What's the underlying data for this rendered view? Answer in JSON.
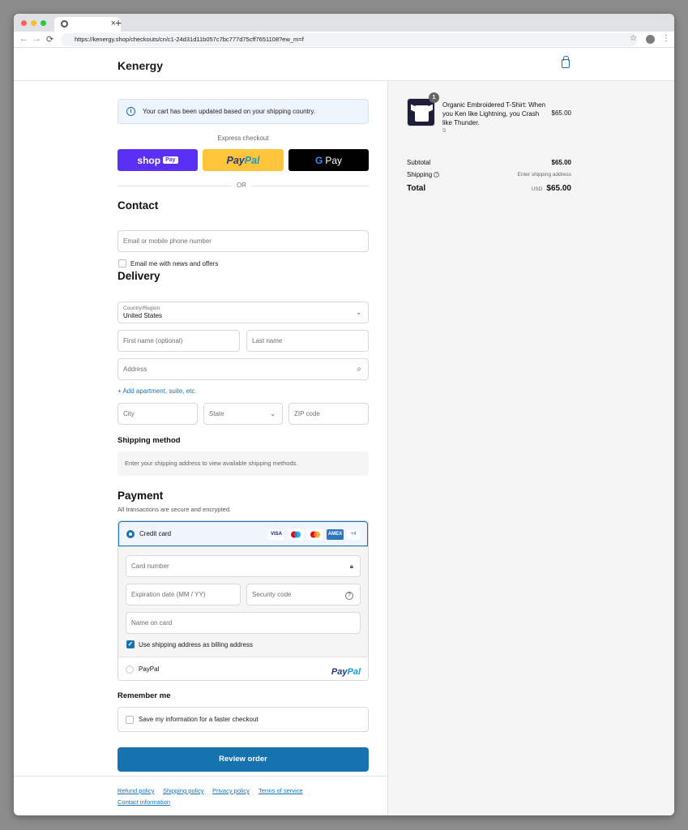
{
  "browser": {
    "tab_close": "×",
    "new_tab": "+",
    "url": "https://kenergy.shop/checkouts/cn/c1-24d31d11b057c7bc777d75cff7651108?ew_m=f",
    "back": "←",
    "forward": "→",
    "reload": "⟳",
    "star": "☆",
    "menu": "⋮"
  },
  "header": {
    "brand": "Kenergy"
  },
  "banner": {
    "icon": "i",
    "text": "Your cart has been updated based on your shipping country."
  },
  "express": {
    "label": "Express checkout",
    "shop_word": "shop",
    "shop_pay": "Pay",
    "paypal_1": "Pay",
    "paypal_2": "Pal",
    "gpay_g": "G",
    "gpay_text": "Pay",
    "or": "OR"
  },
  "contact": {
    "heading": "Contact",
    "email_placeholder": "Email or mobile phone number",
    "news_label": "Email me with news and offers"
  },
  "delivery": {
    "heading": "Delivery",
    "country_label": "Country/Region",
    "country_value": "United States",
    "first_name": "First name (optional)",
    "last_name": "Last name",
    "address": "Address",
    "add_apartment": "+ Add apartment, suite, etc.",
    "city": "City",
    "state": "State",
    "zip": "ZIP code"
  },
  "shipping_method": {
    "heading": "Shipping method",
    "message": "Enter your shipping address to view available shipping methods."
  },
  "payment": {
    "heading": "Payment",
    "subtitle": "All transactions are secure and encrypted.",
    "credit_card": "Credit card",
    "cards": [
      "VISA",
      "Maestro",
      "Mastercard",
      "AMEX"
    ],
    "visa": "VISA",
    "amex": "AMEX",
    "more_cards": "+4",
    "card_number": "Card number",
    "expiration": "Expiration date (MM / YY)",
    "security_code": "Security code",
    "name_on_card": "Name on card",
    "billing_same": "Use shipping address as billing address",
    "billing_checked": true,
    "paypal": "PayPal",
    "paypal_logo_1": "Pay",
    "paypal_logo_2": "Pal"
  },
  "remember": {
    "heading": "Remember me",
    "save_label": "Save my information for a faster checkout"
  },
  "review_button": "Review order",
  "footer": {
    "links": [
      "Refund policy",
      "Shipping policy",
      "Privacy policy",
      "Terms of service",
      "Contact information"
    ]
  },
  "summary": {
    "quantity": "1",
    "product_name": "Organic Embroidered T-Shirt: When you Ken like Lightning, you Crash like Thunder.",
    "variant": "S",
    "price": "$65.00",
    "subtotal_label": "Subtotal",
    "subtotal": "$65.00",
    "shipping_label": "Shipping",
    "shipping_value": "Enter shipping address",
    "total_label": "Total",
    "currency": "USD",
    "total": "$65.00"
  },
  "colors": {
    "accent": "#1773b0",
    "shop_pay": "#5a31f4",
    "paypal_yellow": "#ffc439",
    "gpay_black": "#000000"
  }
}
